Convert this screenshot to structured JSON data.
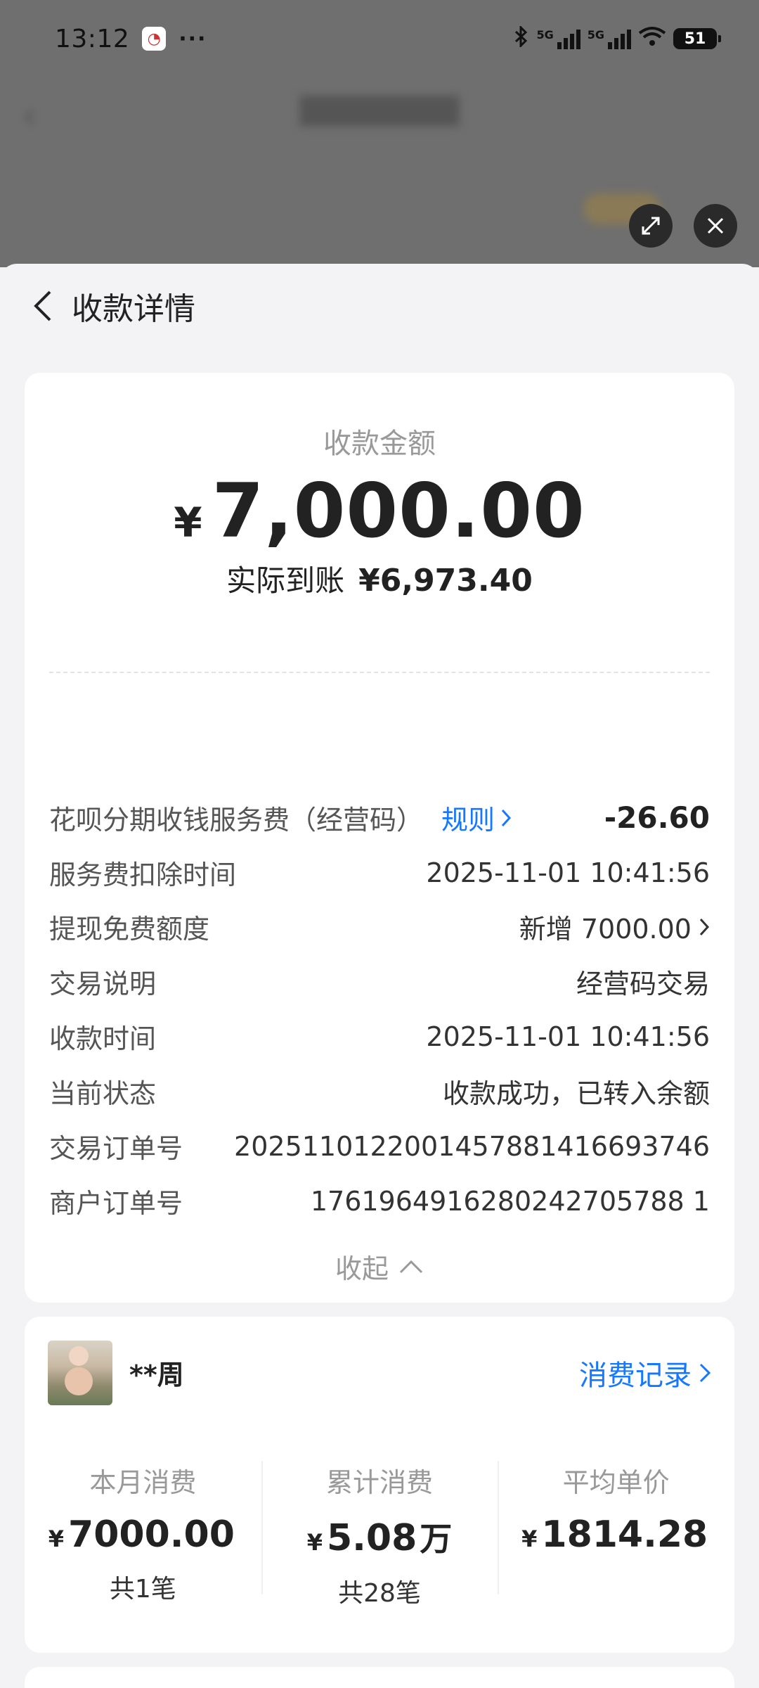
{
  "status_bar": {
    "time": "13:12",
    "dots": "···",
    "battery": "51",
    "net_label": "5G"
  },
  "sheet": {
    "title": "收款详情"
  },
  "summary": {
    "amount_label": "收款金额",
    "currency": "¥",
    "amount": "7,000.00",
    "actual_label": "实际到账",
    "actual_amount": "¥6,973.40"
  },
  "fee": {
    "label": "花呗分期收钱服务费（经营码）",
    "rule_link": "规则",
    "amount": "-26.60",
    "time_label": "服务费扣除时间",
    "time_value": "2025-11-01 10:41:56"
  },
  "details": [
    {
      "label": "提现免费额度",
      "value": "新增 7000.00"
    },
    {
      "label": "交易说明",
      "value": "经营码交易"
    },
    {
      "label": "收款时间",
      "value": "2025-11-01 10:41:56"
    },
    {
      "label": "当前状态",
      "value": "收款成功，已转入余额"
    },
    {
      "label": "交易订单号",
      "value": "2025110122001457881416693746"
    },
    {
      "label": "商户订单号",
      "value": "1761964916280242705788 1"
    }
  ],
  "collapse_label": "收起",
  "customer": {
    "name": "**周",
    "records_link": "消费记录",
    "stats": [
      {
        "label": "本月消费",
        "currency": "¥",
        "value": "7000.00",
        "unit": "",
        "count": "共1笔"
      },
      {
        "label": "累计消费",
        "currency": "¥",
        "value": "5.08",
        "unit": "万",
        "count": "共28笔"
      },
      {
        "label": "平均单价",
        "currency": "¥",
        "value": "1814.28",
        "unit": "",
        "count": ""
      }
    ]
  },
  "colors": {
    "link": "#1677ff",
    "text": "#222222",
    "muted": "#999999"
  }
}
